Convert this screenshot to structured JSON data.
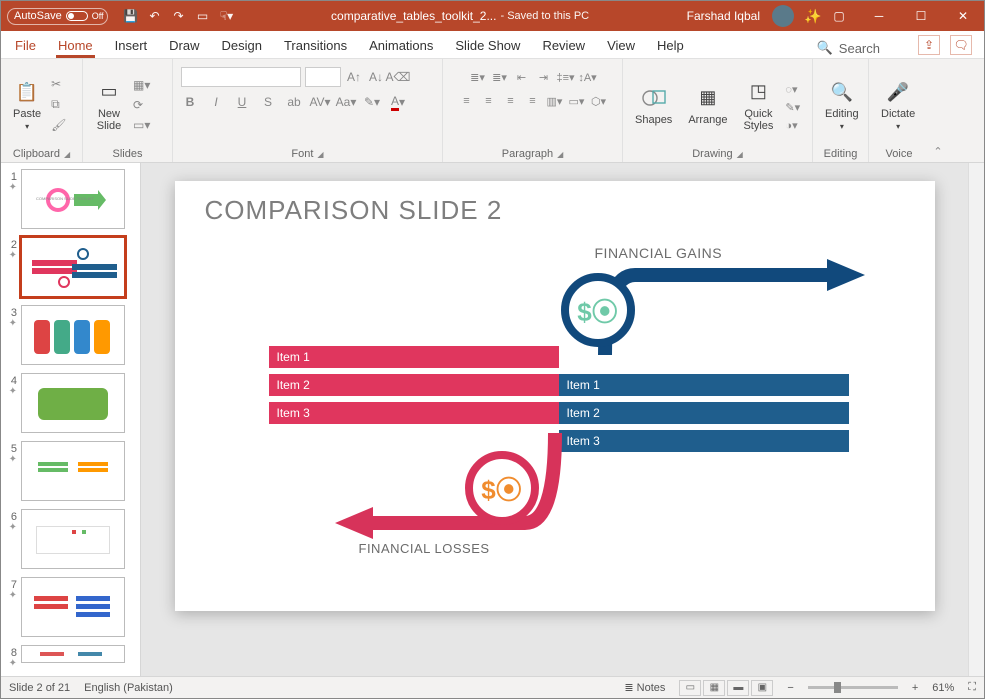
{
  "titlebar": {
    "autosave_label": "AutoSave",
    "autosave_state": "Off",
    "doc_title": "comparative_tables_toolkit_2...",
    "saved_label": "- Saved to this PC",
    "user_name": "Farshad Iqbal"
  },
  "tabs": {
    "file": "File",
    "items": [
      "Home",
      "Insert",
      "Draw",
      "Design",
      "Transitions",
      "Animations",
      "Slide Show",
      "Review",
      "View",
      "Help"
    ],
    "active_index": 0,
    "search_placeholder": "Search"
  },
  "ribbon": {
    "clipboard": {
      "paste": "Paste",
      "label": "Clipboard"
    },
    "slides": {
      "new_slide": "New\nSlide",
      "label": "Slides"
    },
    "font": {
      "label": "Font"
    },
    "paragraph": {
      "label": "Paragraph"
    },
    "drawing": {
      "shapes": "Shapes",
      "arrange": "Arrange",
      "quick": "Quick\nStyles",
      "label": "Drawing"
    },
    "editing": {
      "label": "Editing",
      "btn": "Editing"
    },
    "voice": {
      "label": "Voice",
      "btn": "Dictate"
    }
  },
  "thumbnails": {
    "count_visible": 8,
    "selected": 2
  },
  "slide": {
    "title": "COMPARISON SLIDE 2",
    "gains_label": "FINANCIAL GAINS",
    "losses_label": "FINANCIAL LOSSES",
    "losses_items": [
      "Item 1",
      "Item 2",
      "Item 3"
    ],
    "gains_items": [
      "Item 1",
      "Item 2",
      "Item 3"
    ]
  },
  "status": {
    "slide_count": "Slide 2 of 21",
    "language": "English (Pakistan)",
    "notes": "Notes",
    "zoom": "61%"
  }
}
